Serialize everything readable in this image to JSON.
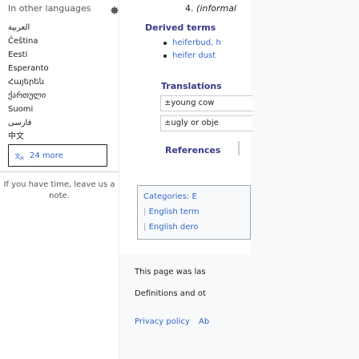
{
  "sidebar": {
    "heading": "In other languages",
    "gear_icon": "gear-icon",
    "languages": [
      "العربية",
      "Čeština",
      "Eesti",
      "Esperanto",
      "Հայերեն",
      "ქართული",
      "Suomi",
      "فارسی",
      "中文"
    ],
    "more_label": "24 more",
    "more_icon": "translate-icon",
    "note": "If you have time, leave us a note."
  },
  "article": {
    "sense_number": "4.",
    "sense_text": "(informal",
    "derived_heading": "Derived terms",
    "derived_terms": [
      "heiferbud, h",
      "heifer dust"
    ],
    "translations_heading": "Translations",
    "translations": [
      {
        "plus": "±",
        "text": "young cow"
      },
      {
        "plus": "±",
        "text": "ugly or obje"
      }
    ],
    "references_heading": "References",
    "categories_label": "Categories:",
    "categories_first": "E",
    "categories": [
      "English term",
      "English dero"
    ]
  },
  "footer": {
    "line1": "This page was las",
    "line2": "Definitions and ot",
    "links": [
      "Privacy policy",
      "Ab"
    ]
  },
  "colors": {
    "link": "#3366cc",
    "heading": "#3a3a8a",
    "text": "#202122",
    "muted": "#54595d",
    "border": "#c8ccd1"
  }
}
